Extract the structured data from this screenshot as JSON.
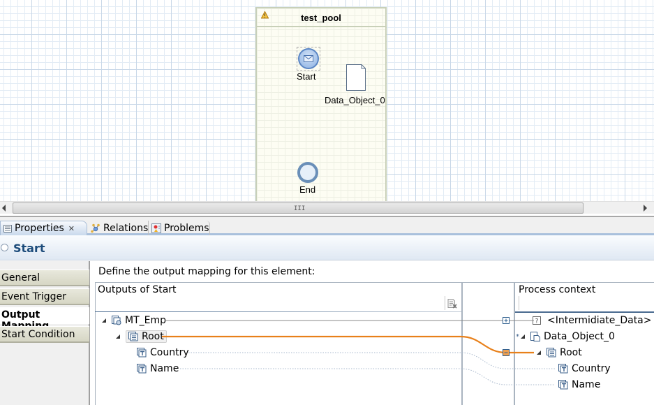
{
  "diagram": {
    "pool": {
      "title": "test_pool",
      "warning_icon": "warning-icon"
    },
    "start_event": {
      "label": "Start",
      "icon": "envelope-icon"
    },
    "data_object": {
      "label": "Data_Object_0"
    },
    "end_event": {
      "label": "End"
    }
  },
  "scrollbar": {
    "grip": "III"
  },
  "tabs": [
    {
      "label": "Properties",
      "icon": "properties-icon",
      "active": true,
      "closable": true
    },
    {
      "label": "Relations",
      "icon": "relations-icon",
      "active": false
    },
    {
      "label": "Problems",
      "icon": "problems-icon",
      "active": false
    }
  ],
  "properties": {
    "title": "Start",
    "side_tabs": [
      {
        "label": "General",
        "active": false
      },
      {
        "label": "Event Trigger",
        "active": false
      },
      {
        "label": "Output Mapping",
        "active": true
      },
      {
        "label": "Start Condition",
        "active": false
      }
    ],
    "description": "Define the output mapping for this element:",
    "left_header": "Outputs of Start",
    "right_header": "Process context",
    "left_tree": [
      {
        "label": "MT_Emp",
        "level": 0,
        "expanded": true,
        "icon": "message-type-icon"
      },
      {
        "label": "Root",
        "level": 1,
        "expanded": true,
        "selected": true,
        "icon": "structure-icon"
      },
      {
        "label": "Country",
        "level": 2,
        "icon": "text-field-icon"
      },
      {
        "label": "Name",
        "level": 2,
        "icon": "text-field-icon"
      }
    ],
    "right_tree": [
      {
        "label": "<Intermidiate_Data>",
        "level": 0,
        "icon": "unknown-type-icon"
      },
      {
        "label": "Data_Object_0",
        "level": 0,
        "expanded": true,
        "marker": "*",
        "icon": "data-object-icon"
      },
      {
        "label": "Root",
        "level": 1,
        "expanded": true,
        "icon": "structure-icon"
      },
      {
        "label": "Country",
        "level": 2,
        "icon": "text-field-icon"
      },
      {
        "label": "Name",
        "level": 2,
        "icon": "text-field-icon"
      }
    ],
    "mapping_color": "#e8801a"
  }
}
